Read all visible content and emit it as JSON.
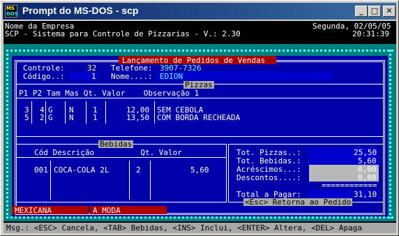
{
  "window": {
    "title": "Prompt do MS-DOS - scp",
    "icon_top": "MS",
    "icon_bottom": "DOS",
    "minimize": "_",
    "maximize": "□",
    "close": "✕"
  },
  "header": {
    "company": "Nome da Empresa",
    "system": "SCP - Sistema para Controle de Pizzarias - V.: 2.30",
    "date": "Segunda, 02/05/05",
    "time": "20:31:39"
  },
  "form": {
    "title": "Lançamento de Pedidos de Vendas",
    "controle_label": "Controle:",
    "controle_value": "32",
    "telefone_label": "Telefone:",
    "telefone_value": "3907-7326",
    "codigo_label": "Código..:",
    "codigo_value": "1",
    "nome_label": "Nome....:",
    "nome_value": "EDION"
  },
  "pizzas": {
    "label": "Pizzas",
    "headers": "P1 P2 Tam Mas Qt. Valor    Observação 1",
    "rows": [
      {
        "p1": "3",
        "p2": "4",
        "tam": "G",
        "mas": "N",
        "qt": "1",
        "valor": "12,00",
        "obs": "SEM CEBOLA"
      },
      {
        "p1": "5",
        "p2": "2",
        "tam": "G",
        "mas": "N",
        "qt": "1",
        "valor": "13,50",
        "obs": "COM BORDA RECHEADA"
      }
    ]
  },
  "bebidas": {
    "label": "Bebidas",
    "headers": "Cód Descrição          Qt. Valor",
    "rows": [
      {
        "cod": "001",
        "desc": "COCA-COLA 2L",
        "qt": "2",
        "valor": "5,60"
      }
    ]
  },
  "totals": {
    "pizzas_label": "Tot. Pizzas..:",
    "pizzas_value": "25,50",
    "bebidas_label": "Tot. Bebidas.:",
    "bebidas_value": "5,60",
    "acrescimos_label": "Acréscimos...:",
    "acrescimos_value": "0,00",
    "descontos_label": "Descontos....:",
    "descontos_value": "0,00",
    "separator": "============",
    "total_label": "Total a Pagar:",
    "total_value": "31,10",
    "esc_hint": "<Esc> Retorna ao Pedido"
  },
  "status": {
    "flavor1": "MEXICANA",
    "flavor2": "A MODA"
  },
  "help": "Msg.: <ESC> Cancela, <TAB> Bebidas, <INS> Inclui, <ENTER> Altera, <DEL> Apaga"
}
